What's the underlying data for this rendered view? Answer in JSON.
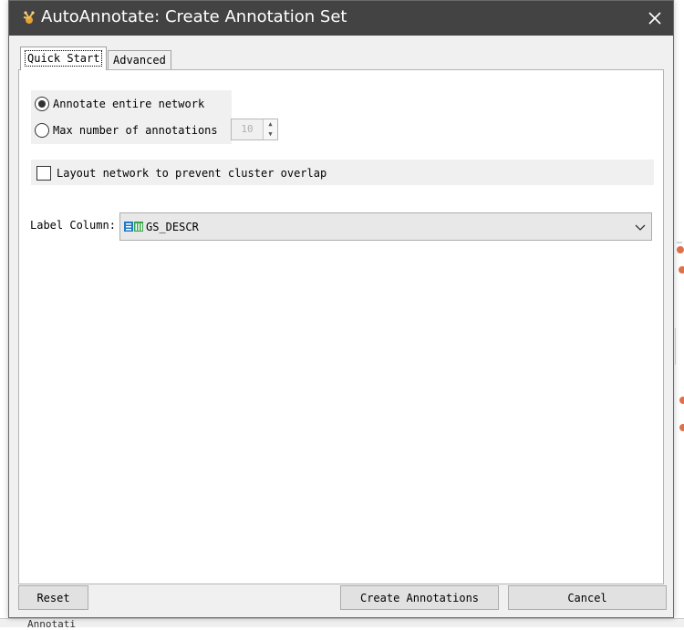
{
  "window": {
    "title": "AutoAnnotate: Create Annotation Set",
    "close_symbol": "✕"
  },
  "tabs": [
    {
      "label": "Quick Start",
      "selected": true
    },
    {
      "label": "Advanced",
      "selected": false
    }
  ],
  "quick_start": {
    "annotate_entire_label": "Annotate entire network",
    "annotate_entire_selected": true,
    "max_annotations_label": "Max number of annotations",
    "max_annotations_selected": false,
    "max_annotations_value": "10",
    "layout_label": "Layout network to prevent cluster overlap",
    "layout_checked": false,
    "label_column_label": "Label Column:",
    "label_column_value": "GS_DESCR",
    "label_column_icon": "string-column-icon"
  },
  "buttons": {
    "reset": "Reset",
    "create": "Create Annotations",
    "cancel": "Cancel"
  },
  "background": {
    "bottom_text": "Annotati"
  },
  "colors": {
    "titlebar": "#434343",
    "dialog_bg": "#f0f0f0",
    "panel_bg": "#ffffff",
    "button_bg": "#e1e1e1",
    "column_icon_blue": "#1f78c8",
    "column_icon_green": "#3aa34a"
  }
}
